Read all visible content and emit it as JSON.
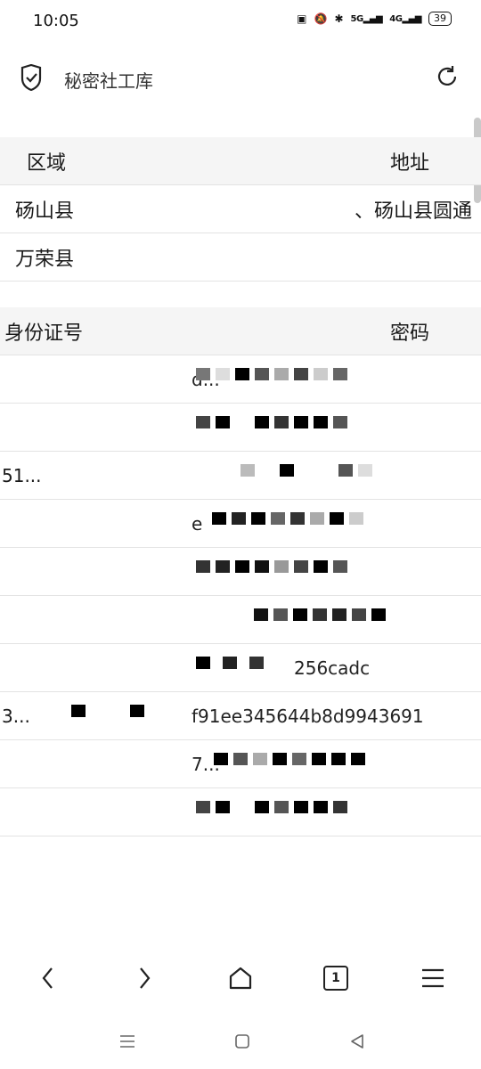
{
  "status_bar": {
    "time": "10:05",
    "signal1": "5G",
    "signal2": "4G",
    "battery": "39"
  },
  "header": {
    "title": "秘密社工库"
  },
  "table_region": {
    "headers": [
      "区域",
      "地址"
    ],
    "rows": [
      {
        "region": "砀山县",
        "address": "、砀山县圆通"
      },
      {
        "region": "万荣县",
        "address": ""
      }
    ]
  },
  "table_credentials": {
    "headers": [
      "身份证号",
      "密码"
    ],
    "rows": [
      {
        "id": "",
        "pw": "d..."
      },
      {
        "id": "",
        "pw": ""
      },
      {
        "id": "51...",
        "pw": ""
      },
      {
        "id": "",
        "pw": "e"
      },
      {
        "id": "",
        "pw": ""
      },
      {
        "id": "",
        "pw": ""
      },
      {
        "id": "",
        "pw": "256cadc"
      },
      {
        "id": "3...",
        "pw": "f91ee345644b8d9943691"
      },
      {
        "id": "",
        "pw": "7..."
      },
      {
        "id": "",
        "pw": ""
      }
    ]
  },
  "bottom_nav": {
    "tab_count": "1",
    "icons": [
      "back-icon",
      "forward-icon",
      "home-icon",
      "tabs-icon",
      "menu-icon"
    ]
  },
  "system_nav": {
    "icons": [
      "recent-apps-icon",
      "home-square-icon",
      "back-triangle-icon"
    ]
  }
}
